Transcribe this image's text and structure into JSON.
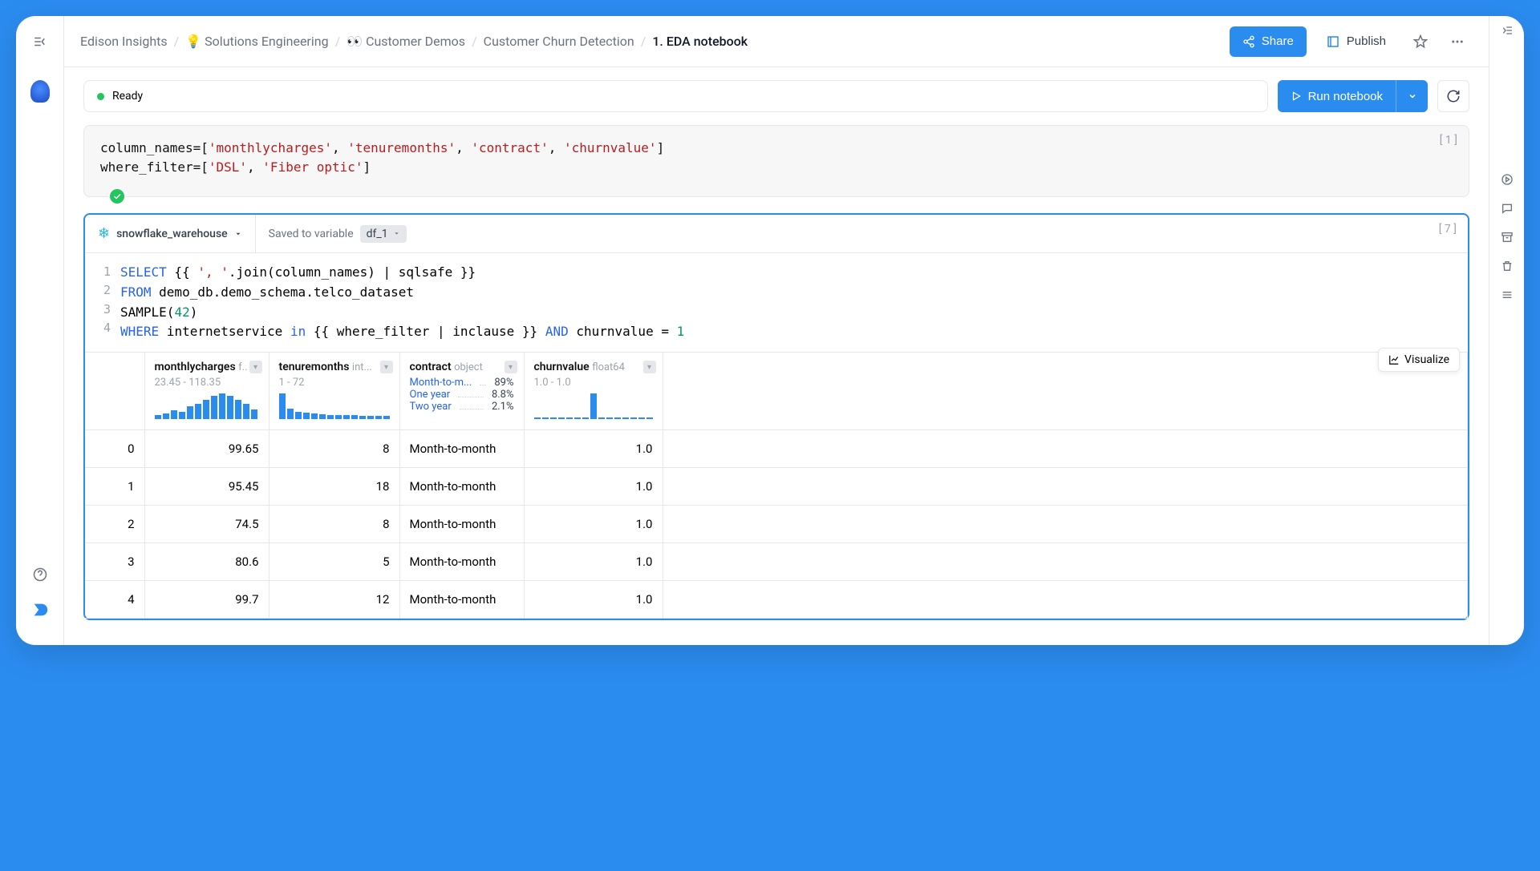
{
  "breadcrumbs": {
    "root": "Edison Insights",
    "l1": "💡 Solutions Engineering",
    "l2": "👀 Customer Demos",
    "l3": "Customer Churn Detection",
    "current": "1. EDA notebook"
  },
  "actions": {
    "share": "Share",
    "publish": "Publish"
  },
  "status": {
    "label": "Ready",
    "run": "Run notebook"
  },
  "cell1": {
    "num": "[ 1 ]",
    "line1_pre": "column_names=[",
    "line1_vals": [
      "'monthlycharges'",
      "'tenuremonths'",
      "'contract'",
      "'churnvalue'"
    ],
    "line2_pre": "where_filter=[",
    "line2_vals": [
      "'DSL'",
      "'Fiber optic'"
    ]
  },
  "cell2": {
    "num": "[ 7 ]",
    "warehouse": "snowflake_warehouse",
    "saved_label": "Saved to variable",
    "var_name": "df_1",
    "visualize": "Visualize",
    "sql": {
      "l1a": "SELECT",
      "l1b": " {{ ",
      "l1c": "', '",
      "l1d": ".join(column_names) | sqlsafe }}",
      "l2a": "FROM",
      "l2b": " demo_db.demo_schema.telco_dataset",
      "l3a": "SAMPLE(",
      "l3b": "42",
      "l3c": ")",
      "l4a": "WHERE",
      "l4b": " internetservice ",
      "l4c": "in",
      "l4d": " {{ where_filter | inclause }} ",
      "l4e": "AND",
      "l4f": " churnvalue = ",
      "l4g": "1"
    }
  },
  "table": {
    "columns": [
      {
        "name": "monthlycharges",
        "type": "f..",
        "range": "23.45 - 118.35",
        "spark": [
          12,
          18,
          28,
          22,
          40,
          48,
          60,
          70,
          78,
          72,
          60,
          48,
          30
        ]
      },
      {
        "name": "tenuremonths",
        "type": "int...",
        "range": "1 - 72",
        "spark": [
          80,
          32,
          24,
          20,
          18,
          16,
          14,
          14,
          12,
          12,
          10,
          10,
          10,
          10
        ]
      },
      {
        "name": "contract",
        "type": "object",
        "cats": [
          {
            "name": "Month-to-m...",
            "pct": "89%"
          },
          {
            "name": "One year",
            "pct": "8.8%"
          },
          {
            "name": "Two year",
            "pct": "2.1%"
          }
        ]
      },
      {
        "name": "churnvalue",
        "type": "float64",
        "range": "1.0 - 1.0",
        "spark": [
          0,
          0,
          0,
          0,
          0,
          0,
          0,
          80,
          0,
          0,
          0,
          0,
          0,
          0,
          0
        ]
      }
    ],
    "rows": [
      {
        "idx": "0",
        "c0": "99.65",
        "c1": "8",
        "c2": "Month-to-month",
        "c3": "1.0"
      },
      {
        "idx": "1",
        "c0": "95.45",
        "c1": "18",
        "c2": "Month-to-month",
        "c3": "1.0"
      },
      {
        "idx": "2",
        "c0": "74.5",
        "c1": "8",
        "c2": "Month-to-month",
        "c3": "1.0"
      },
      {
        "idx": "3",
        "c0": "80.6",
        "c1": "5",
        "c2": "Month-to-month",
        "c3": "1.0"
      },
      {
        "idx": "4",
        "c0": "99.7",
        "c1": "12",
        "c2": "Month-to-month",
        "c3": "1.0"
      }
    ]
  },
  "chart_data": [
    {
      "type": "bar",
      "title": "monthlycharges distribution",
      "x_range": [
        23.45,
        118.35
      ],
      "values": [
        12,
        18,
        28,
        22,
        40,
        48,
        60,
        70,
        78,
        72,
        60,
        48,
        30
      ]
    },
    {
      "type": "bar",
      "title": "tenuremonths distribution",
      "x_range": [
        1,
        72
      ],
      "values": [
        80,
        32,
        24,
        20,
        18,
        16,
        14,
        14,
        12,
        12,
        10,
        10,
        10,
        10
      ]
    },
    {
      "type": "bar",
      "title": "contract categories",
      "categories": [
        "Month-to-month",
        "One year",
        "Two year"
      ],
      "values": [
        89,
        8.8,
        2.1
      ]
    },
    {
      "type": "bar",
      "title": "churnvalue distribution",
      "x_range": [
        1.0,
        1.0
      ],
      "values": [
        0,
        0,
        0,
        0,
        0,
        0,
        0,
        80,
        0,
        0,
        0,
        0,
        0,
        0,
        0
      ]
    }
  ]
}
